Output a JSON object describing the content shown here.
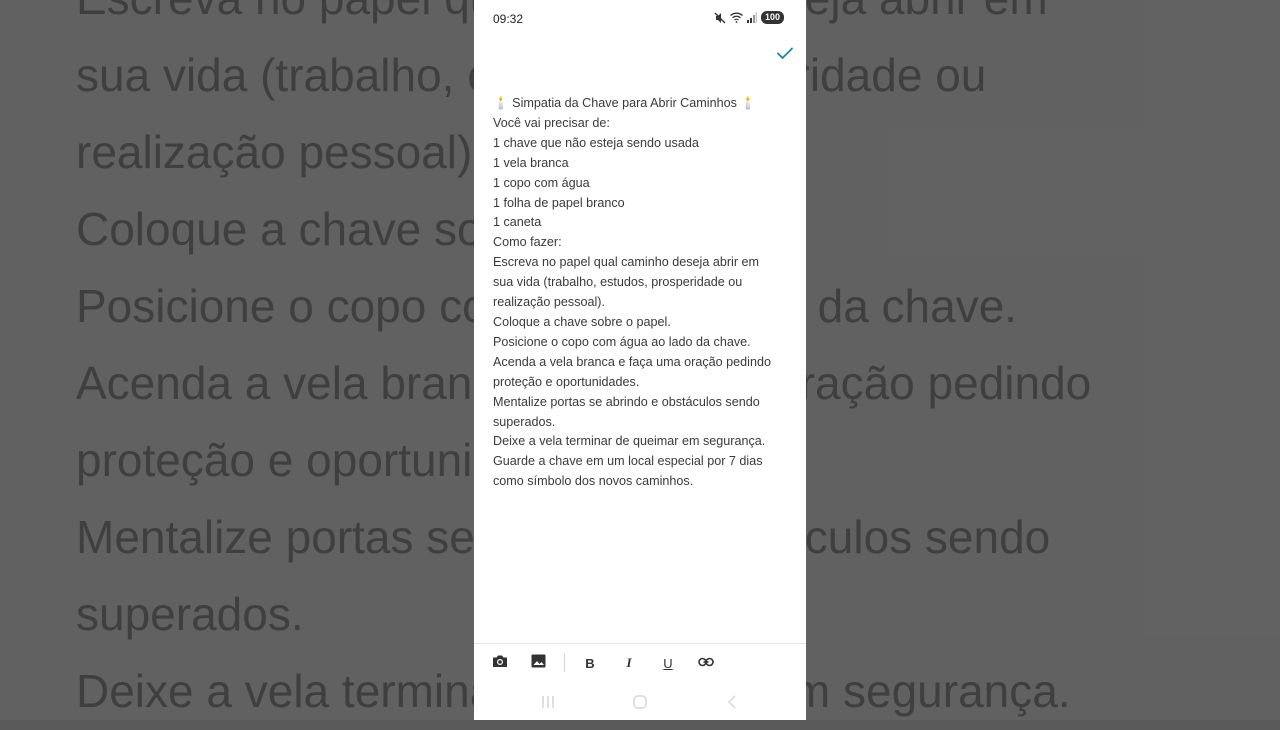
{
  "background_lines": [
    "Escreva no papel qual caminho deseja abrir em",
    "sua vida (trabalho, estudos, prosperidade ou",
    "realização pessoal).",
    "Coloque a chave sobre o papel.",
    "Posicione o copo com água ao lado da chave.",
    "Acenda a vela branca e faça uma oração pedindo",
    "proteção e oportunidades.",
    "Mentalize portas se abrindo e obstáculos sendo",
    "superados.",
    "Deixe a vela terminar de queimar em segurança."
  ],
  "status": {
    "time": "09:32",
    "battery": "100"
  },
  "note": {
    "lines": [
      "🕯️ Simpatia da Chave para Abrir Caminhos 🕯️",
      "Você vai precisar de:",
      "1 chave que não esteja sendo usada",
      "1 vela branca",
      "1 copo com água",
      "1 folha de papel branco",
      "1 caneta",
      "Como fazer:",
      "Escreva no papel qual caminho deseja abrir em",
      "sua vida (trabalho, estudos, prosperidade ou",
      "realização pessoal).",
      "Coloque a chave sobre o papel.",
      "Posicione o copo com água ao lado da chave.",
      "Acenda a vela branca e faça uma oração pedindo",
      "proteção e oportunidades.",
      "Mentalize portas se abrindo e obstáculos sendo",
      "superados.",
      "Deixe a vela terminar de queimar em segurança.",
      "Guarde a chave em um local especial por 7 dias",
      "como símbolo dos novos caminhos."
    ]
  },
  "toolbar": {
    "bold": "B",
    "italic": "I",
    "underline": "U"
  },
  "colors": {
    "accent": "#1a8a99"
  },
  "icons": {
    "save": "check-icon",
    "camera": "camera-icon",
    "image": "image-icon",
    "link": "link-icon"
  }
}
